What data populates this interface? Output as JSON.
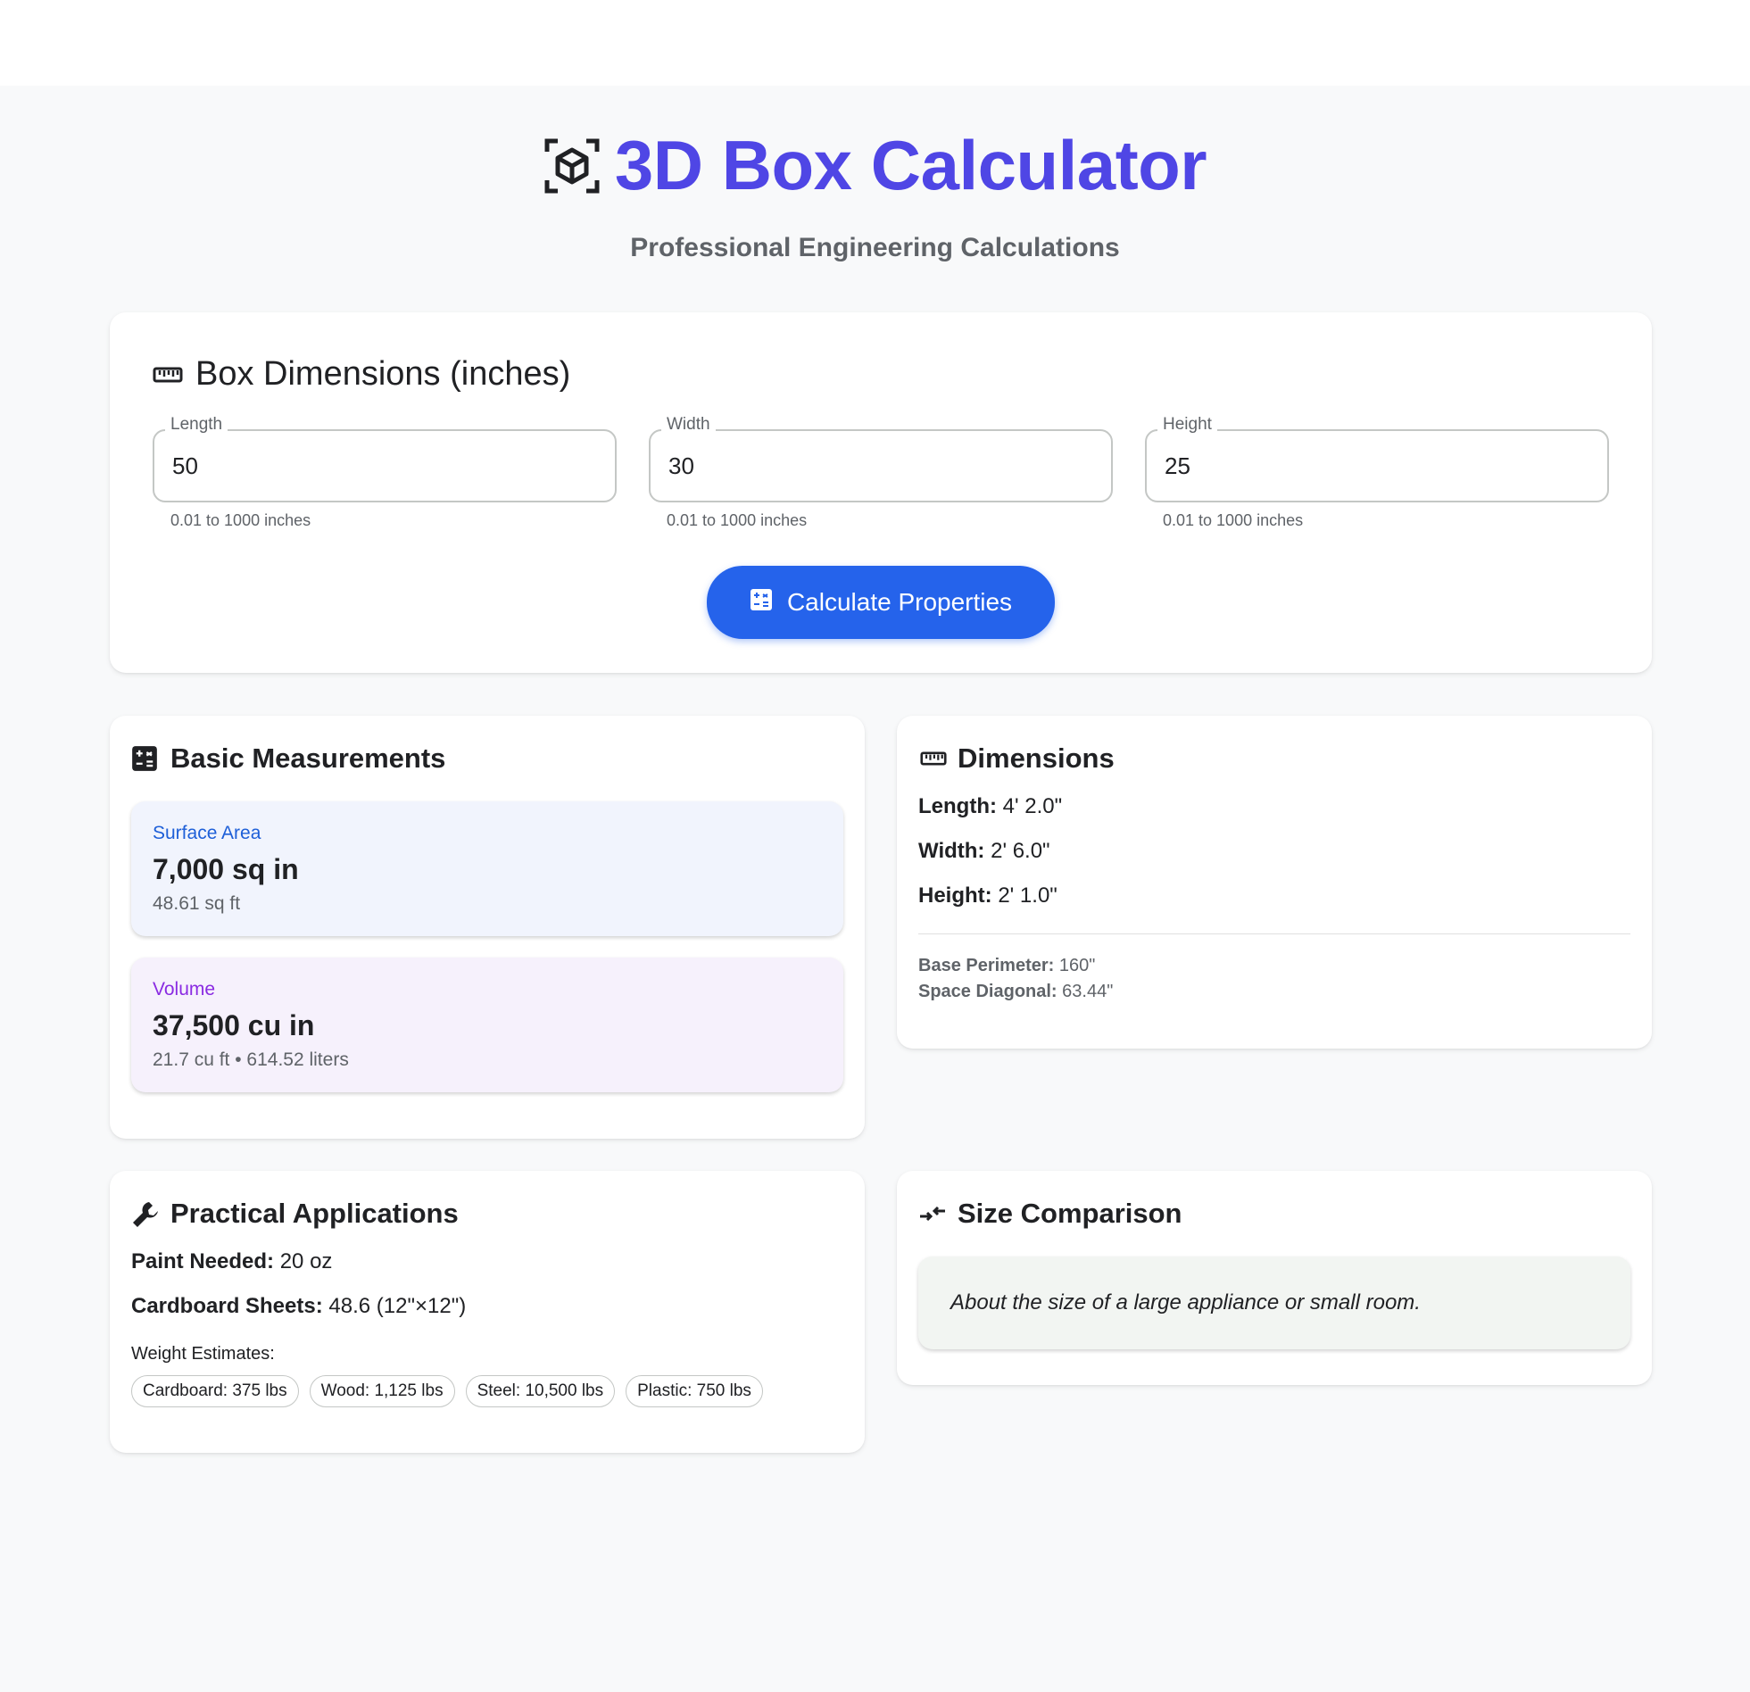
{
  "header": {
    "title": "3D Box Calculator",
    "subtitle": "Professional Engineering Calculations",
    "icon": "view-in-ar-icon",
    "accent_color": "#4f46e5"
  },
  "dimensions_form": {
    "title": "Box Dimensions (inches)",
    "fields": [
      {
        "label": "Length",
        "value": "50",
        "helper": "0.01 to 1000 inches"
      },
      {
        "label": "Width",
        "value": "30",
        "helper": "0.01 to 1000 inches"
      },
      {
        "label": "Height",
        "value": "25",
        "helper": "0.01 to 1000 inches"
      }
    ],
    "button_label": "Calculate Properties",
    "button_color": "#2563eb"
  },
  "basic_measurements": {
    "title": "Basic Measurements",
    "surface_area": {
      "label": "Surface Area",
      "value": "7,000 sq in",
      "sub": "48.61 sq ft"
    },
    "volume": {
      "label": "Volume",
      "value": "37,500 cu in",
      "sub": "21.7 cu ft • 614.52 liters"
    }
  },
  "dimensions_info": {
    "title": "Dimensions",
    "rows": [
      {
        "key": "Length:",
        "value": "4' 2.0\""
      },
      {
        "key": "Width:",
        "value": "2' 6.0\""
      },
      {
        "key": "Height:",
        "value": "2' 1.0\""
      }
    ],
    "base_perimeter": {
      "key": "Base Perimeter:",
      "value": "160\""
    },
    "space_diagonal": {
      "key": "Space Diagonal:",
      "value": "63.44\""
    }
  },
  "practical": {
    "title": "Practical Applications",
    "paint": {
      "key": "Paint Needed:",
      "value": "20 oz"
    },
    "cardboard": {
      "key": "Cardboard Sheets:",
      "value": "48.6 (12\"×12\")"
    },
    "weight_label": "Weight Estimates:",
    "weights": [
      "Cardboard: 375 lbs",
      "Wood: 1,125 lbs",
      "Steel: 10,500 lbs",
      "Plastic: 750 lbs"
    ]
  },
  "comparison": {
    "title": "Size Comparison",
    "text": "About the size of a large appliance or small room."
  }
}
